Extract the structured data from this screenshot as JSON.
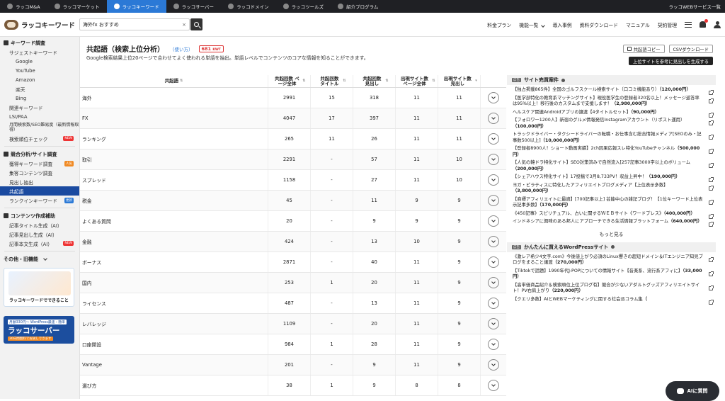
{
  "topbar": {
    "tabs": [
      {
        "label": "ラッコM&A",
        "active": false
      },
      {
        "label": "ラッコマーケット",
        "active": false
      },
      {
        "label": "ラッコキーワード",
        "active": true
      },
      {
        "label": "ラッコサーバー",
        "active": false
      },
      {
        "label": "ラッコドメイン",
        "active": false
      },
      {
        "label": "ラッコツールズ",
        "active": false
      },
      {
        "label": "紹介プログラム",
        "active": false
      }
    ],
    "right_label": "ラッコWEBサービス一覧"
  },
  "header": {
    "logo": "ラッコキーワード",
    "search_value": "海外fx おすすめ",
    "clear": "×",
    "nav": [
      "料金プラン",
      "機能一覧",
      "導入事例",
      "資料ダウンロード",
      "マニュアル",
      "契約管理"
    ]
  },
  "sidebar": {
    "section1": "キーワード調査",
    "suggest": "サジェストキーワード",
    "suggest_subs": [
      "Google",
      "YouTube",
      "Amazon",
      "楽天",
      "Bing"
    ],
    "related": "関連キーワード",
    "lsi": "LSI/PAA",
    "monthly": "月間検索数/SEO難易度（最新情報取得）",
    "rank_check": "検索順位チェック",
    "badge_new": "NEW",
    "section2": "競合分析/サイト調査",
    "acquired": "獲得キーワード調査",
    "badge_popular": "人気",
    "traffic": "集客コンテンツ調査",
    "headings": "見出し抽出",
    "cooccur": "共起語",
    "rankin": "ランクインキーワード",
    "badge_update": "更新",
    "section3": "コンテンツ作成補助",
    "gen_title": "記事タイトル生成（AI）",
    "gen_heading": "記事見出し生成（AI）",
    "gen_body": "記事本文生成（AI）",
    "others": "その他・旧機能",
    "promo1_text": "ラッコキーワードでできること",
    "promo2_l1": "月額330円〜 WordPress最速・簡単",
    "promo2_l2": "ラッコサーバー",
    "promo2_l3": "30日間無料でお試しできます"
  },
  "main": {
    "title": "共起語（検索上位分析）",
    "howto": "（使い方）",
    "count": "681",
    "count_unit": "KWT",
    "description": "Google検索結果上位20ページで合わせてよく使われる単語を抽出。単語レベルでコンテンツのコアな情報を知ることができます。",
    "copy_btn": "共起語コピー",
    "csv_btn": "CSVダウンロード",
    "draft_btn": "上位サイトを参考に見出しを生成する",
    "columns": [
      "共起語",
      "共起回数 ページ全体",
      "共起回数 タイトル",
      "共起回数 見出し",
      "出現サイト数 ページ全体",
      "出現サイト数 見出し"
    ],
    "rows": [
      [
        "海外",
        "2991",
        "15",
        "318",
        "11",
        "11"
      ],
      [
        "FX",
        "4047",
        "17",
        "397",
        "11",
        "11"
      ],
      [
        "ランキング",
        "265",
        "11",
        "26",
        "11",
        "11"
      ],
      [
        "取引",
        "2291",
        "-",
        "57",
        "11",
        "10"
      ],
      [
        "スプレッド",
        "1158",
        "-",
        "27",
        "11",
        "10"
      ],
      [
        "税金",
        "45",
        "-",
        "11",
        "9",
        "9"
      ],
      [
        "よくある質問",
        "20",
        "-",
        "9",
        "9",
        "9"
      ],
      [
        "金融",
        "424",
        "-",
        "13",
        "10",
        "9"
      ],
      [
        "ボーナス",
        "2871",
        "-",
        "40",
        "11",
        "9"
      ],
      [
        "国内",
        "253",
        "1",
        "20",
        "11",
        "9"
      ],
      [
        "ライセンス",
        "487",
        "-",
        "13",
        "11",
        "9"
      ],
      [
        "レバレッジ",
        "1109",
        "-",
        "20",
        "11",
        "9"
      ],
      [
        "口座開設",
        "984",
        "1",
        "28",
        "11",
        "9"
      ],
      [
        "Vantage",
        "201",
        "-",
        "9",
        "11",
        "9"
      ],
      [
        "選び方",
        "38",
        "1",
        "9",
        "8",
        "8"
      ]
    ]
  },
  "side": {
    "ad_label": "広告",
    "sites_title": "サイト売買案件",
    "sites": [
      {
        "text": "【独占掲載865件】全国のゴルフスクール検索サイト（口コミ機能あり）",
        "price": "（120,000円）"
      },
      {
        "text": "【医学部特化の教育系マッチングサイト】現役医学生の登録者320名以上！メッセージ返答率は95%以上！移行後のカスタムまで支援します！",
        "price": "（2,980,000円）"
      },
      {
        "text": "ヘルスケア関連Androidアプリの譲渡【4タイトルセット】",
        "price": "（90,000円）"
      },
      {
        "text": "【フォロワー1200人】新宿のグルメ情報発信Instagramアカウント（リポスト運用）",
        "price": "（100,000円）"
      },
      {
        "text": "トラックドライバー・タクシードライバーの転職・お仕事含む総合情報メディア[SEOのみ・記事数500以上]",
        "price": "（10,000,000円）"
      },
      {
        "text": "【登録者8900人！ショート動画実績】2ch因果応報スレ特化YouTubeチャンネル",
        "price": "（500,000円）"
      },
      {
        "text": "【人気の韓ドラ特化サイト】SEO対策済みで自然流入[257記事3000字以上のボリューム",
        "price": "（200,000円）"
      },
      {
        "text": "【シェアハウス特化サイト】17投稿で3月8,733PV！収益上昇中！",
        "price": "（190,000円）"
      },
      {
        "text": "ヨガ・ピラティスに特化したアフィリエイトブログメディア【上位表示多数】",
        "price": "（3,800,000円）"
      },
      {
        "text": "【商標アフィリエイトに最適】[700記事以上] 芸能中心の雑記ブログ！【1位キーワード上位表示記事多数】",
        "price": "（170,000円）"
      },
      {
        "text": "《450記事》スピリチュアル、占いに関するＷＥＢサイト《ワードプレス》",
        "price": "（400,000円）"
      },
      {
        "text": "インドネシアに興味のある邦人にアプローチできる生活情報プラットフォーム",
        "price": "（640,000円）"
      }
    ],
    "more": "もっと見る",
    "wp_title": "かんたんに買えるWordPressサイト",
    "wp": [
      {
        "text": "《激レア希少4文字.com》今後値上がり必須のLinux響きの超短ドメイン＆ITエンジニア知見ブログをまること譲渡",
        "price": "（270,000円）"
      },
      {
        "text": "【Tiktokで話題】1990年代J-POPについての情報サイト【音楽系、流行系アフィに】",
        "price": "（33,000円）"
      },
      {
        "text": "【高単価商品紹介＆検索順位上位ブログ有】競合が少ないアダルトグッズアフィリエイトサイト！PV右肩上がり",
        "price": "（220,000円）"
      },
      {
        "text": "【クエリ多数】AIとWEBマーケティングに関する社会派コラム集",
        "price": "（"
      }
    ],
    "ai_button": "AIに質問"
  }
}
